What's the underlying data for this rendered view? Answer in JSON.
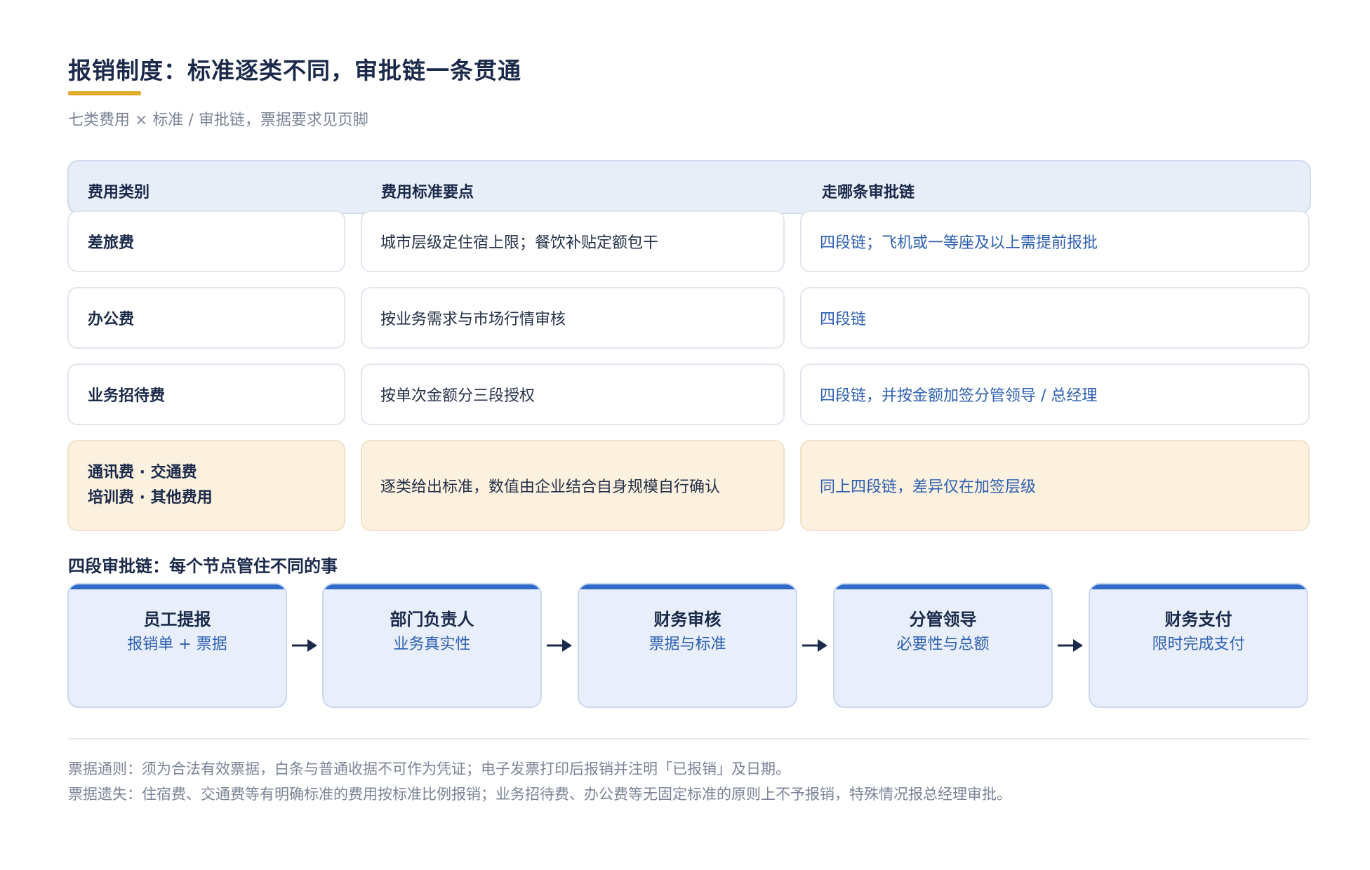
{
  "title": "报销制度：标准逐类不同，审批链一条贯通",
  "subtitle": "七类费用 × 标准 / 审批链，票据要求见页脚",
  "table": {
    "headers": [
      "费用类别",
      "费用标准要点",
      "走哪条审批链"
    ],
    "rows": [
      {
        "category": "差旅费",
        "standard": "城市层级定住宿上限；餐饮补贴定额包干",
        "chain": "四段链；飞机或一等座及以上需提前报批"
      },
      {
        "category": "办公费",
        "standard": "按业务需求与市场行情审核",
        "chain": "四段链"
      },
      {
        "category": "业务招待费",
        "standard": "按单次金额分三段授权",
        "chain": "四段链，并按金额加签分管领导 / 总经理"
      },
      {
        "category_line1": "通讯费 · 交通费",
        "category_line2": "培训费 · 其他费用",
        "standard": "逐类给出标准，数值由企业结合自身规模自行确认",
        "chain": "同上四段链，差异仅在加签层级"
      }
    ]
  },
  "flow": {
    "title": "四段审批链：每个节点管住不同的事",
    "steps": [
      {
        "title": "员工提报",
        "desc": "报销单 + 票据"
      },
      {
        "title": "部门负责人",
        "desc": "业务真实性"
      },
      {
        "title": "财务审核",
        "desc": "票据与标准"
      },
      {
        "title": "分管领导",
        "desc": "必要性与总额"
      },
      {
        "title": "财务支付",
        "desc": "限时完成支付"
      }
    ]
  },
  "footer": {
    "note1": "票据通则：须为合法有效票据，白条与普通收据不可作为凭证；电子发票打印后报销并注明「已报销」及日期。",
    "note2": "票据遗失：住宿费、交通费等有明确标准的费用按标准比例报销；业务招待费、办公费等无固定标准的原则上不予报销，特殊情况报总经理审批。"
  },
  "colors": {
    "accent_gold": "#e3ab2a",
    "accent_blue": "#2f6bc7",
    "chain_text": "#2d5fb0",
    "highlight_row": "#fcf1df",
    "header_bg": "#e8eef8"
  }
}
